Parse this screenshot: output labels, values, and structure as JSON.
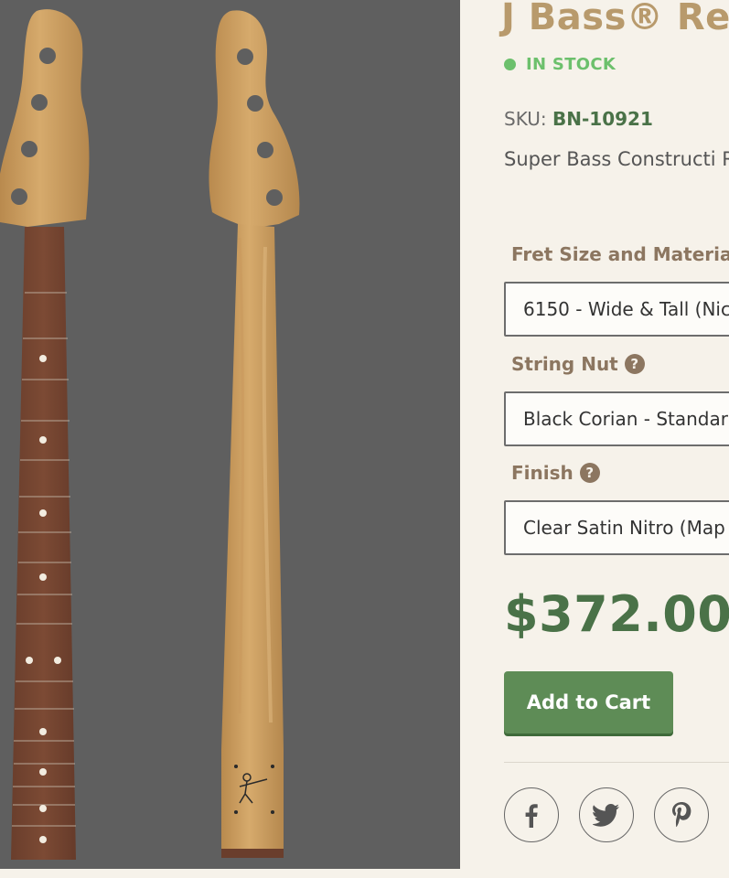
{
  "product": {
    "title": "J Bass® Repl",
    "stock_status": "IN STOCK",
    "sku_label": "SKU:",
    "sku_value": "BN-10921",
    "description": "Super Bass Constructi Radius",
    "price": "$372.00",
    "add_to_cart_label": "Add to Cart"
  },
  "options": {
    "fret": {
      "label": "Fret Size and Materia",
      "selected": "6150 - Wide & Tall (Nic"
    },
    "nut": {
      "label": "String Nut",
      "selected": "Black Corian - Standar"
    },
    "finish": {
      "label": "Finish",
      "selected": "Clear Satin Nitro (Map"
    }
  },
  "share": {
    "icons": [
      "facebook-icon",
      "twitter-icon",
      "pinterest-icon"
    ]
  },
  "colors": {
    "title": "#b89a6c",
    "in_stock": "#6cc06c",
    "price": "#4a7248",
    "button": "#5e8c56",
    "photo_bg": "#5f5f5f"
  }
}
